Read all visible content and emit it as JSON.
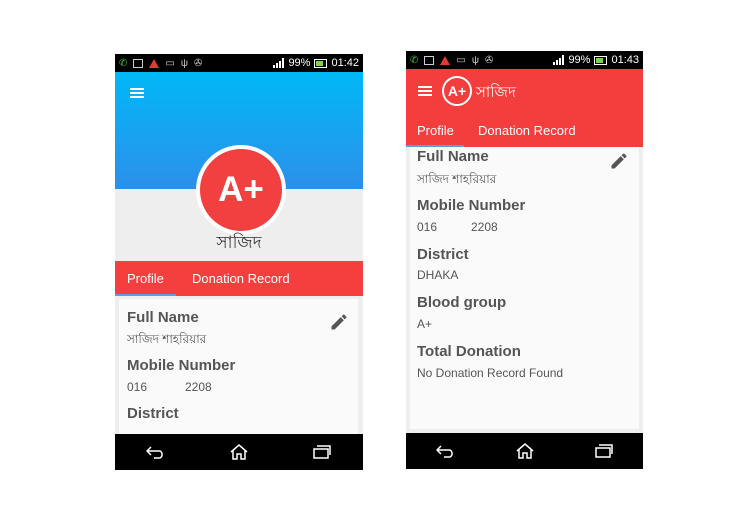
{
  "phone1": {
    "status": {
      "battery": "99%",
      "time": "01:42"
    },
    "badge": "A+",
    "name": "সাজিদ",
    "tabs": [
      {
        "label": "Profile"
      },
      {
        "label": "Donation Record"
      }
    ],
    "fields": [
      {
        "label": "Full Name",
        "value": "সাজিদ শাহরিয়ার"
      },
      {
        "label": "Mobile Number",
        "value_prefix": "016",
        "value_suffix": "2208"
      },
      {
        "label": "District"
      }
    ],
    "icons": [
      "menu-icon",
      "edit-pencil-icon",
      "back-icon",
      "home-icon",
      "recent-apps-icon"
    ]
  },
  "phone2": {
    "status": {
      "battery": "99%",
      "time": "01:43"
    },
    "badge": "A+",
    "title": "সাজিদ",
    "tabs": [
      {
        "label": "Profile"
      },
      {
        "label": "Donation Record"
      }
    ],
    "fields": [
      {
        "label": "Full Name",
        "value": "সাজিদ শাহরিয়ার"
      },
      {
        "label": "Mobile Number",
        "value_prefix": "016",
        "value_suffix": "2208"
      },
      {
        "label": "District",
        "value": "DHAKA"
      },
      {
        "label": "Blood group",
        "value": "A+"
      },
      {
        "label": "Total Donation",
        "value": "No Donation Record Found"
      }
    ],
    "icons": [
      "menu-icon",
      "edit-pencil-icon",
      "back-icon",
      "home-icon",
      "recent-apps-icon"
    ]
  },
  "colors": {
    "accent_red": "#f43d3d",
    "hero_blue": "#1aa3f2",
    "tab_indicator": "#5a9fe0"
  }
}
